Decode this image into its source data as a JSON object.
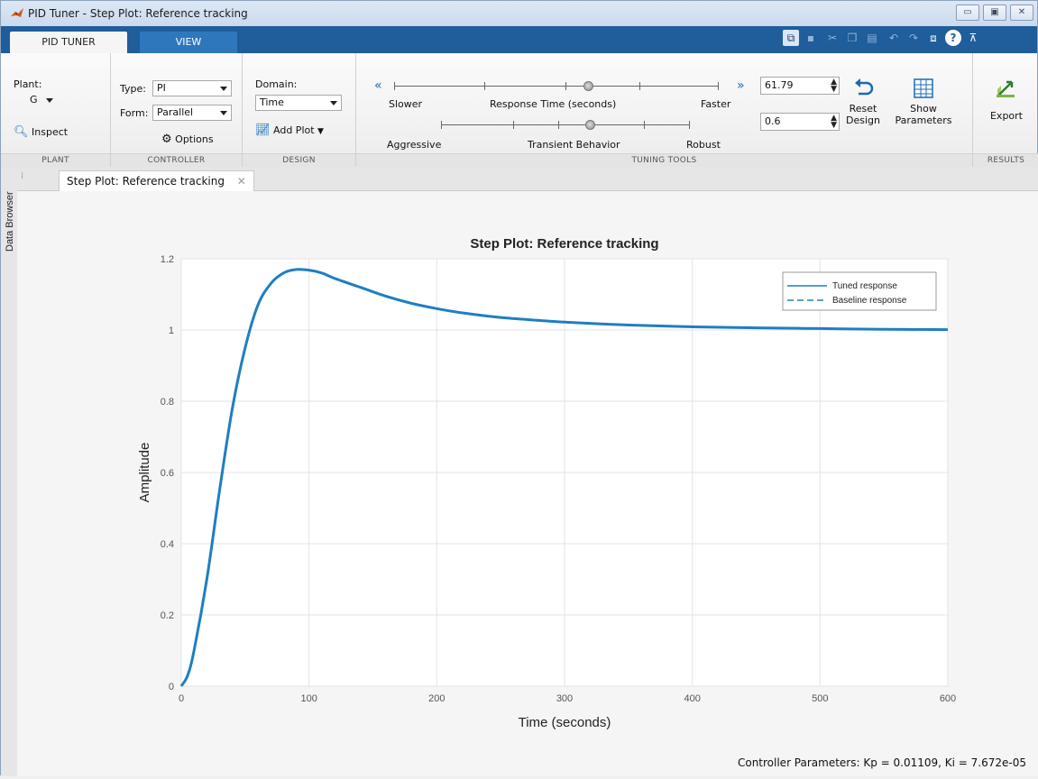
{
  "window": {
    "title": "PID Tuner - Step Plot: Reference tracking"
  },
  "ribbon_tabs": [
    {
      "label": "PID TUNER",
      "active": true
    },
    {
      "label": "VIEW",
      "active": false
    }
  ],
  "plant": {
    "label": "Plant:",
    "value": "G",
    "inspect": "Inspect",
    "section": "PLANT"
  },
  "controller": {
    "type_label": "Type:",
    "type_value": "PI",
    "form_label": "Form:",
    "form_value": "Parallel",
    "options": "Options",
    "section": "CONTROLLER"
  },
  "design": {
    "domain_label": "Domain:",
    "domain_value": "Time",
    "add_plot": "Add Plot",
    "section": "DESIGN"
  },
  "tuning": {
    "response_slower": "Slower",
    "response_label": "Response Time (seconds)",
    "response_faster": "Faster",
    "response_value": "61.79",
    "transient_left": "Aggressive",
    "transient_label": "Transient Behavior",
    "transient_right": "Robust",
    "transient_value": "0.6",
    "reset": [
      "Reset",
      "Design"
    ],
    "show": [
      "Show",
      "Parameters"
    ],
    "section": "TUNING TOOLS",
    "response_slider_fraction": 0.6,
    "transient_slider_fraction": 0.6
  },
  "results": {
    "export": "Export",
    "section": "RESULTS"
  },
  "side_panel": {
    "label": "Data Browser"
  },
  "doc_tab": {
    "label": "Step Plot: Reference tracking"
  },
  "status": "Controller Parameters: Kp = 0.01109, Ki = 7.672e-05",
  "chart_data": {
    "type": "line",
    "title": "Step Plot: Reference tracking",
    "xlabel": "Time (seconds)",
    "ylabel": "Amplitude",
    "xlim": [
      0,
      600
    ],
    "ylim": [
      0,
      1.2
    ],
    "xticks": [
      0,
      100,
      200,
      300,
      400,
      500,
      600
    ],
    "yticks": [
      0,
      0.2,
      0.4,
      0.6,
      0.8,
      1,
      1.2
    ],
    "grid": true,
    "legend_position": "top-right",
    "series": [
      {
        "name": "Tuned response",
        "style": "solid",
        "color": "#1f7ec2",
        "x": [
          0,
          5,
          10,
          20,
          30,
          40,
          50,
          60,
          70,
          80,
          90,
          100,
          110,
          120,
          140,
          160,
          180,
          200,
          220,
          250,
          280,
          300,
          350,
          400,
          450,
          500,
          550,
          600
        ],
        "y": [
          0,
          0.03,
          0.1,
          0.3,
          0.55,
          0.78,
          0.95,
          1.07,
          1.13,
          1.16,
          1.17,
          1.168,
          1.16,
          1.145,
          1.12,
          1.095,
          1.075,
          1.06,
          1.048,
          1.035,
          1.027,
          1.022,
          1.014,
          1.009,
          1.006,
          1.004,
          1.002,
          1.001
        ]
      },
      {
        "name": "Baseline response",
        "style": "dashed",
        "color": "#1f7ec2",
        "x": [],
        "y": []
      }
    ]
  }
}
